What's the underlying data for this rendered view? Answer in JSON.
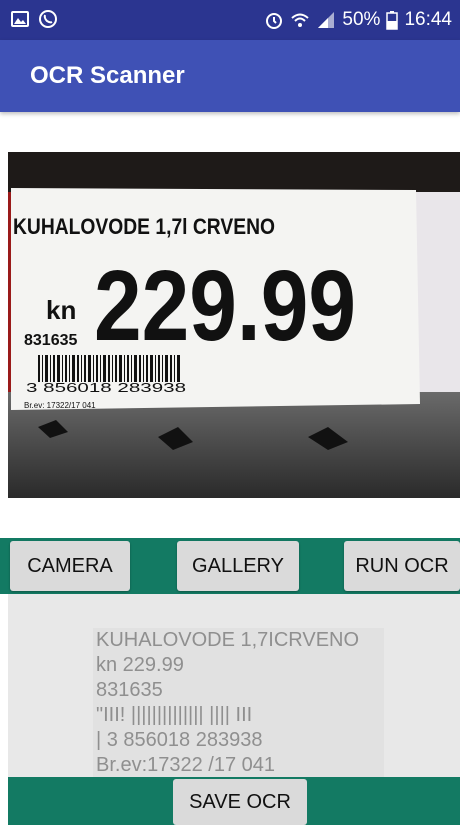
{
  "status_bar": {
    "battery": "50%",
    "time": "16:44",
    "icons": [
      "gallery-icon",
      "viber-icon",
      "alarm-icon",
      "wifi-icon",
      "signal-icon",
      "battery-icon"
    ]
  },
  "app_bar": {
    "title": "OCR Scanner",
    "color": "#3f51b5"
  },
  "photo": {
    "label_title": "KUHALOVODE 1,7l CRVENO",
    "currency": "kn",
    "price": "229.99",
    "code": "831635",
    "barcode_digits": "3 856018 283938",
    "reg": "Br.ev: 17322/17  041"
  },
  "buttons": {
    "camera": "CAMERA",
    "gallery": "GALLERY",
    "run_ocr": "RUN OCR",
    "save_ocr": "SAVE OCR"
  },
  "ocr_result": {
    "text": "KUHALOVODE 1,7ICRVENO\nkn 229.99\n831635\n\"III! |||||||||||||| |||| III\n| 3 856018 283938\nBr.ev:17322 /17 041"
  },
  "colors": {
    "status_bar": "#2b3590",
    "button_strip": "#137a63"
  }
}
